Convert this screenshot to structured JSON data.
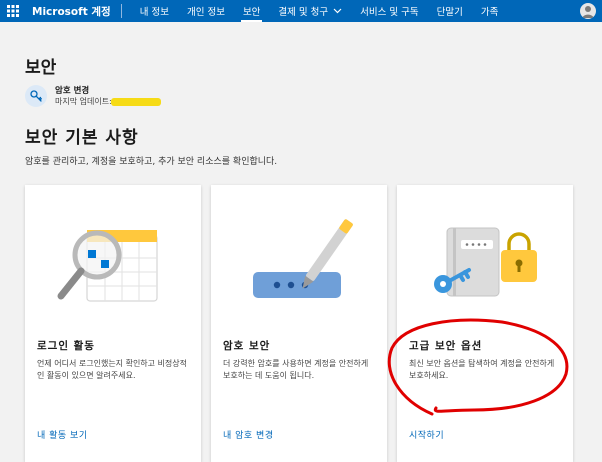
{
  "nav": {
    "brand": "Microsoft 계정",
    "items": [
      {
        "label": "내 정보"
      },
      {
        "label": "개인 정보"
      },
      {
        "label": "보안"
      },
      {
        "label": "결제 및 청구"
      },
      {
        "label": "서비스 및 구독"
      },
      {
        "label": "단말기"
      },
      {
        "label": "가족"
      }
    ]
  },
  "page": {
    "title": "보안",
    "password": {
      "title": "암호 변경",
      "subtitle": "마지막 업데이트:"
    },
    "section_title": "보안 기본 사항",
    "section_desc": "암호를 관리하고, 계정을 보호하고, 추가 보안 리소스를 확인합니다."
  },
  "cards": [
    {
      "title": "로그인 활동",
      "desc": "언제 어디서 로그인했는지 확인하고 비정상적인 활동이 있으면 알려주세요.",
      "link": "내 활동 보기"
    },
    {
      "title": "암호 보안",
      "desc": "더 강력한 암호를 사용하면 계정을 안전하게 보호하는 데 도움이 됩니다.",
      "link": "내 암호 변경"
    },
    {
      "title": "고급 보안 옵션",
      "desc": "최신 보안 옵션을 탐색하여 계정을 안전하게 보호하세요.",
      "link": "시작하기"
    }
  ],
  "colors": {
    "accent": "#0067b8",
    "annotation": "#e00000",
    "highlight": "#f5d90a"
  }
}
